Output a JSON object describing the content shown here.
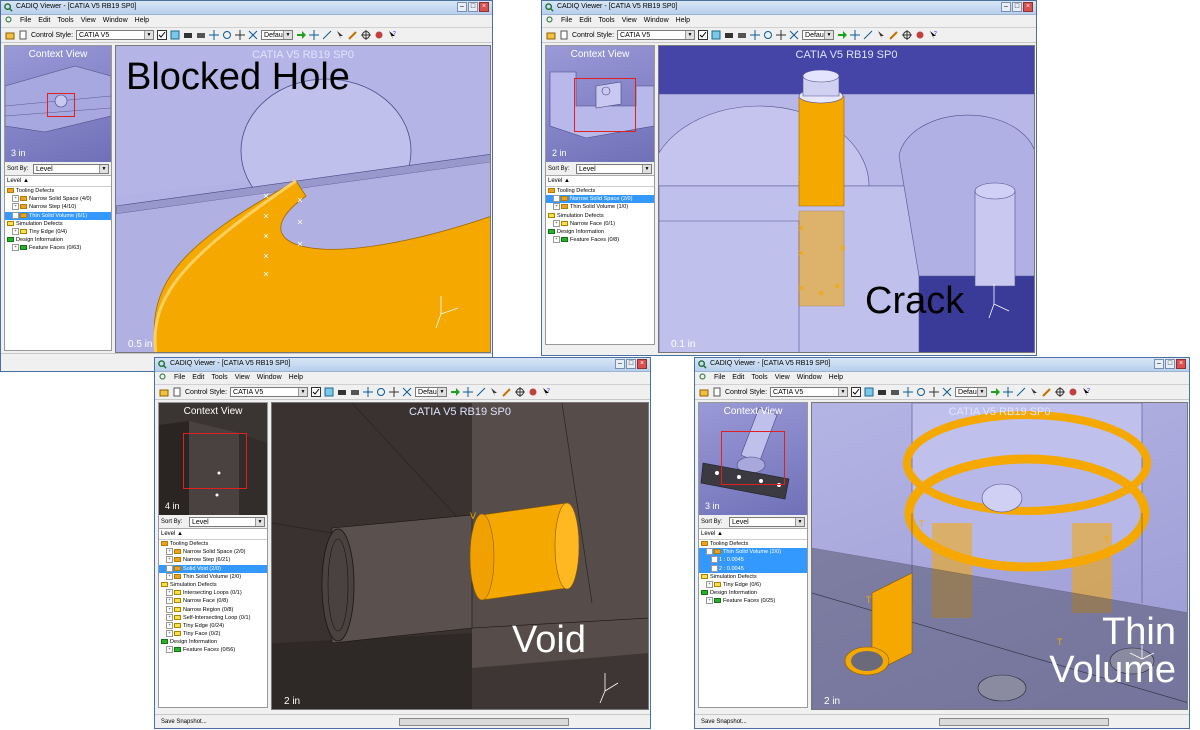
{
  "colors": {
    "accent_orange": "#f5a800",
    "selection_blue": "#3399ff",
    "viewport_lavender": "#b4b4e4",
    "viewport_dark": "#4a4240"
  },
  "windows": [
    {
      "id": "blocked-hole",
      "title": "CADIQ Viewer - [CATIA V5 RB19 SP0]",
      "menus": [
        "File",
        "Edit",
        "Tools",
        "View",
        "Window",
        "Help"
      ],
      "toolbar": {
        "control_style_label": "Control Style:",
        "control_style_value": "CATIA V5",
        "default_value": "Default"
      },
      "context_view": {
        "title": "Context View",
        "scale": "3 in"
      },
      "sort": {
        "label": "Sort By:",
        "value": "Level"
      },
      "tree": {
        "header": "Level",
        "items": [
          {
            "label": "Tooling Defects",
            "depth": 0,
            "color": "orange"
          },
          {
            "label": "Narrow Solid Space (4/0)",
            "depth": 1,
            "color": "orange",
            "exp": "+"
          },
          {
            "label": "Narrow Step (4/10)",
            "depth": 1,
            "color": "orange",
            "exp": "+"
          },
          {
            "label": "Thin Solid Volume (6/1)",
            "depth": 1,
            "color": "orange",
            "exp": "+",
            "selected": true
          },
          {
            "label": "Simulation Defects",
            "depth": 0,
            "color": "yellow"
          },
          {
            "label": "Tiny Edge (0/4)",
            "depth": 1,
            "color": "yellow",
            "exp": "+"
          },
          {
            "label": "Design Information",
            "depth": 0,
            "color": "green"
          },
          {
            "label": "Feature Faces (0/63)",
            "depth": 1,
            "color": "green",
            "exp": "+"
          }
        ]
      },
      "viewport": {
        "title": "CATIA V5 RB19 SP0",
        "scale": "0.5 in"
      },
      "caption": "Blocked Hole"
    },
    {
      "id": "crack",
      "title": "CADIQ Viewer - [CATIA V5 RB19 SP0]",
      "menus": [
        "File",
        "Edit",
        "Tools",
        "View",
        "Window",
        "Help"
      ],
      "toolbar": {
        "control_style_label": "Control Style:",
        "control_style_value": "CATIA V5",
        "default_value": "Default"
      },
      "context_view": {
        "title": "Context View",
        "scale": "2 in"
      },
      "sort": {
        "label": "Sort By:",
        "value": "Level"
      },
      "tree": {
        "header": "Level",
        "items": [
          {
            "label": "Tooling Defects",
            "depth": 0,
            "color": "orange"
          },
          {
            "label": "Narrow Solid Space (2/0)",
            "depth": 1,
            "color": "orange",
            "exp": "+",
            "selected": true
          },
          {
            "label": "Thin Solid Volume (1/0)",
            "depth": 1,
            "color": "orange",
            "exp": "+"
          },
          {
            "label": "Simulation Defects",
            "depth": 0,
            "color": "yellow"
          },
          {
            "label": "Narrow Face (0/1)",
            "depth": 1,
            "color": "yellow",
            "exp": "+"
          },
          {
            "label": "Design Information",
            "depth": 0,
            "color": "green"
          },
          {
            "label": "Feature Faces (0/8)",
            "depth": 1,
            "color": "green",
            "exp": "+"
          }
        ]
      },
      "viewport": {
        "title": "CATIA V5 RB19 SP0",
        "scale": "0.1 in"
      },
      "caption": "Crack"
    },
    {
      "id": "void",
      "title": "CADIQ Viewer - [CATIA V5 RB19 SP0]",
      "menus": [
        "File",
        "Edit",
        "Tools",
        "View",
        "Window",
        "Help"
      ],
      "toolbar": {
        "control_style_label": "Control Style:",
        "control_style_value": "CATIA V5",
        "default_value": "Default"
      },
      "context_view": {
        "title": "Context View",
        "scale": "4 in"
      },
      "sort": {
        "label": "Sort By:",
        "value": "Level"
      },
      "tree": {
        "header": "Level",
        "items": [
          {
            "label": "Tooling Defects",
            "depth": 0,
            "color": "orange"
          },
          {
            "label": "Narrow Solid Space (2/0)",
            "depth": 1,
            "color": "orange",
            "exp": "+"
          },
          {
            "label": "Narrow Step (6/21)",
            "depth": 1,
            "color": "orange",
            "exp": "+"
          },
          {
            "label": "Solid Void (2/0)",
            "depth": 1,
            "color": "orange",
            "exp": "+",
            "selected": true
          },
          {
            "label": "Thin Solid Volume (2/0)",
            "depth": 1,
            "color": "orange",
            "exp": "+"
          },
          {
            "label": "Simulation Defects",
            "depth": 0,
            "color": "yellow"
          },
          {
            "label": "Intersecting Loops (0/1)",
            "depth": 1,
            "color": "yellow",
            "exp": "+"
          },
          {
            "label": "Narrow Face (0/8)",
            "depth": 1,
            "color": "yellow",
            "exp": "+"
          },
          {
            "label": "Narrow Region (0/8)",
            "depth": 1,
            "color": "yellow",
            "exp": "+"
          },
          {
            "label": "Self-Intersecting Loop (0/1)",
            "depth": 1,
            "color": "yellow",
            "exp": "+"
          },
          {
            "label": "Tiny Edge (0/24)",
            "depth": 1,
            "color": "yellow",
            "exp": "+"
          },
          {
            "label": "Tiny Face (0/2)",
            "depth": 1,
            "color": "yellow",
            "exp": "+"
          },
          {
            "label": "Design Information",
            "depth": 0,
            "color": "green"
          },
          {
            "label": "Feature Faces (0/56)",
            "depth": 1,
            "color": "green",
            "exp": "+"
          }
        ]
      },
      "viewport": {
        "title": "CATIA V5 RB19 SP0",
        "scale": "2 in"
      },
      "status": "Save Snapshot...",
      "caption": "Void"
    },
    {
      "id": "thin-volume",
      "title": "CADIQ Viewer - [CATIA V5 RB19 SP0]",
      "menus": [
        "File",
        "Edit",
        "Tools",
        "View",
        "Window",
        "Help"
      ],
      "toolbar": {
        "control_style_label": "Control Style:",
        "control_style_value": "CATIA V5",
        "default_value": "Default"
      },
      "context_view": {
        "title": "Context View",
        "scale": "3 in"
      },
      "sort": {
        "label": "Sort By:",
        "value": "Level"
      },
      "tree": {
        "header": "Level",
        "items": [
          {
            "label": "Tooling Defects",
            "depth": 0,
            "color": "orange"
          },
          {
            "label": "Thin Solid Volume (2/0)",
            "depth": 1,
            "color": "orange",
            "exp": "-",
            "selected": true
          },
          {
            "label": "1 : 0.0045",
            "depth": 2,
            "color": "none",
            "selected": true
          },
          {
            "label": "2 : 0.0045",
            "depth": 2,
            "color": "none",
            "selected": true
          },
          {
            "label": "Simulation Defects",
            "depth": 0,
            "color": "yellow"
          },
          {
            "label": "Tiny Edge (0/6)",
            "depth": 1,
            "color": "yellow",
            "exp": "+"
          },
          {
            "label": "Design Information",
            "depth": 0,
            "color": "green"
          },
          {
            "label": "Feature Faces (0/25)",
            "depth": 1,
            "color": "green",
            "exp": "+"
          }
        ]
      },
      "viewport": {
        "title": "CATIA V5 RB19 SP0",
        "scale": "2 in"
      },
      "status": "Save Snapshot...",
      "caption": "Thin\nVolume"
    }
  ]
}
